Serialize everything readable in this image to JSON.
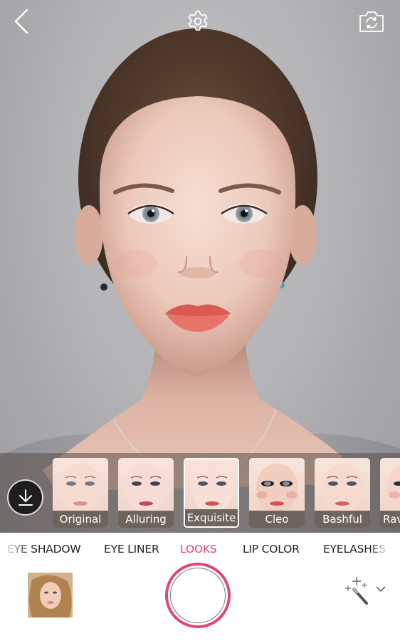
{
  "app": {
    "screen": "makeup-camera"
  },
  "top_bar": {
    "back_icon": "chevron-left-icon",
    "settings_icon": "gear-icon",
    "switch_camera_icon": "camera-switch-icon"
  },
  "looks": {
    "download_icon": "download-icon",
    "items": [
      {
        "label": "Original",
        "selected": false
      },
      {
        "label": "Alluring",
        "selected": false
      },
      {
        "label": "Exquisite",
        "selected": true
      },
      {
        "label": "Cleo",
        "selected": false
      },
      {
        "label": "Bashful",
        "selected": false
      },
      {
        "label": "Rav",
        "selected": false
      }
    ]
  },
  "tabs": [
    {
      "label": "EYE SHADOW",
      "active": false
    },
    {
      "label": "EYE LINER",
      "active": false
    },
    {
      "label": "LOOKS",
      "active": true
    },
    {
      "label": "LIP COLOR",
      "active": false
    },
    {
      "label": "EYELASHES",
      "active": false
    }
  ],
  "bottom": {
    "gallery_icon": "gallery-thumbnail",
    "shutter_icon": "shutter-button",
    "effects_icon": "magic-wand-icon",
    "dropdown_icon": "chevron-down-icon"
  },
  "colors": {
    "accent": "#e0467a",
    "tab_text": "#222222",
    "shutter_ring": "#e0467a"
  }
}
